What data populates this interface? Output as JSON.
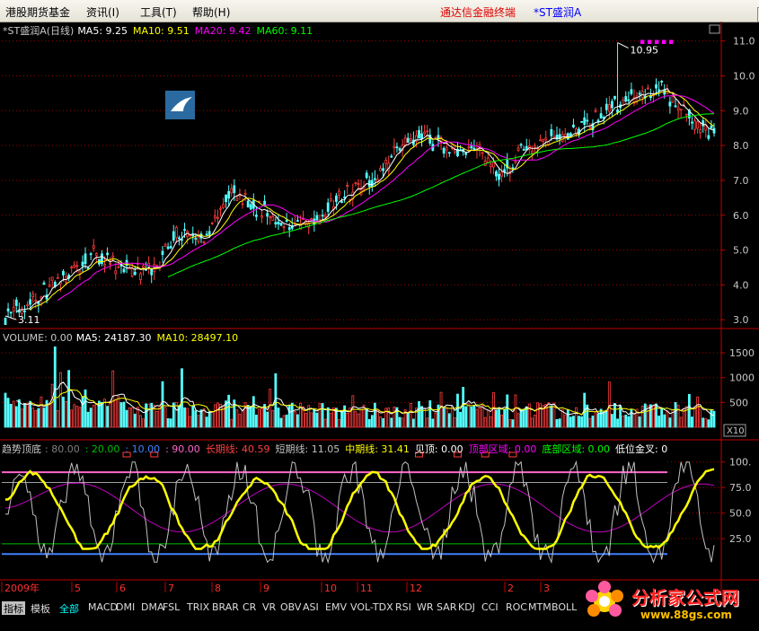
{
  "menu": {
    "items": [
      "港股期货基金",
      "资讯(I)",
      "工具(T)",
      "帮助(H)"
    ],
    "app_title": "通达信金融终端",
    "stock_tag": "*ST盛润A",
    "buttons": [
      "_",
      "□",
      "×"
    ]
  },
  "price_panel": {
    "header": [
      {
        "text": "*ST盛润A(日线)",
        "color": "#c8c8c8"
      },
      {
        "text": "MA5: 9.25",
        "color": "#ffffff"
      },
      {
        "text": "MA10: 9.51",
        "color": "#ffff00"
      },
      {
        "text": "MA20: 9.42",
        "color": "#ff00ff"
      },
      {
        "text": "MA60: 9.11",
        "color": "#00ff00"
      }
    ],
    "y_ticks": [
      "11.0",
      "10.0",
      "9.0",
      "8.0",
      "7.0",
      "6.0",
      "5.0",
      "4.0",
      "3.0"
    ],
    "y_values": [
      11,
      10,
      9,
      8,
      7,
      6,
      5,
      4,
      3
    ],
    "high_label": "10.95",
    "low_label": "3.11",
    "min_price": 3.11,
    "max_price": 10.95
  },
  "volume_panel": {
    "header": [
      {
        "text": "VOLUME: 0.00",
        "color": "#c8c8c8"
      },
      {
        "text": "MA5: 24187.30",
        "color": "#ffffff"
      },
      {
        "text": "MA10: 28497.10",
        "color": "#ffff00"
      }
    ],
    "y_ticks": [
      "1500",
      "1000",
      "500"
    ],
    "y_values": [
      1500,
      1000,
      500
    ],
    "unit": "X10"
  },
  "indicator_panel": {
    "header": [
      {
        "text": "趋势顶底",
        "color": "#c8c8c8"
      },
      {
        "text": ": 80.00",
        "color": "#808080"
      },
      {
        "text": ": 20.00",
        "color": "#00c000"
      },
      {
        "text": ": 10.00",
        "color": "#4080ff"
      },
      {
        "text": ": 90.00",
        "color": "#ff66cc"
      },
      {
        "text": "长期线: 40.59",
        "color": "#ff4040"
      },
      {
        "text": "短期线: 11.05",
        "color": "#c0c0c0"
      },
      {
        "text": "中期线: 31.41",
        "color": "#ffff00"
      },
      {
        "text": "见顶: 0.00",
        "color": "#ffffff"
      },
      {
        "text": "顶部区域: 0.00",
        "color": "#ff00ff"
      },
      {
        "text": "底部区域: 0.00",
        "color": "#00ff00"
      },
      {
        "text": "低位金叉: 0",
        "color": "#ffffff"
      }
    ],
    "y_ticks": [
      "100.",
      "75.0",
      "50.0",
      "25.0"
    ],
    "y_values": [
      100,
      75,
      50,
      25
    ],
    "levels": {
      "top": 90,
      "upper": 80,
      "lower": 20,
      "bottom": 10
    }
  },
  "time_axis": {
    "labels": [
      "2009年",
      "5",
      "6",
      "7",
      "8",
      "9",
      "10",
      "11",
      "12",
      "2",
      "3"
    ],
    "label_color": "#ff3030"
  },
  "tabs": {
    "left": [
      "指标",
      "模板"
    ],
    "items": [
      "全部",
      "MACD",
      "DMI",
      "DMA",
      "FSL",
      "TRIX",
      "BRAR",
      "CR",
      "VR",
      "OBV",
      "ASI",
      "EMV",
      "VOL-TDX",
      "RSI",
      "WR",
      "SAR",
      "KDJ",
      "CCI",
      "ROC",
      "MTM",
      "BOLL"
    ]
  },
  "brand": {
    "name": "分析家公式网",
    "url": "www.88gs.com"
  },
  "colors": {
    "up": "#ff3c3c",
    "down": "#54ffff",
    "ma5": "#ffffff",
    "ma10": "#ffff00",
    "ma20": "#ff00ff",
    "ma60": "#00ff00",
    "grid": "#a00000",
    "axis": "#c00000"
  }
}
